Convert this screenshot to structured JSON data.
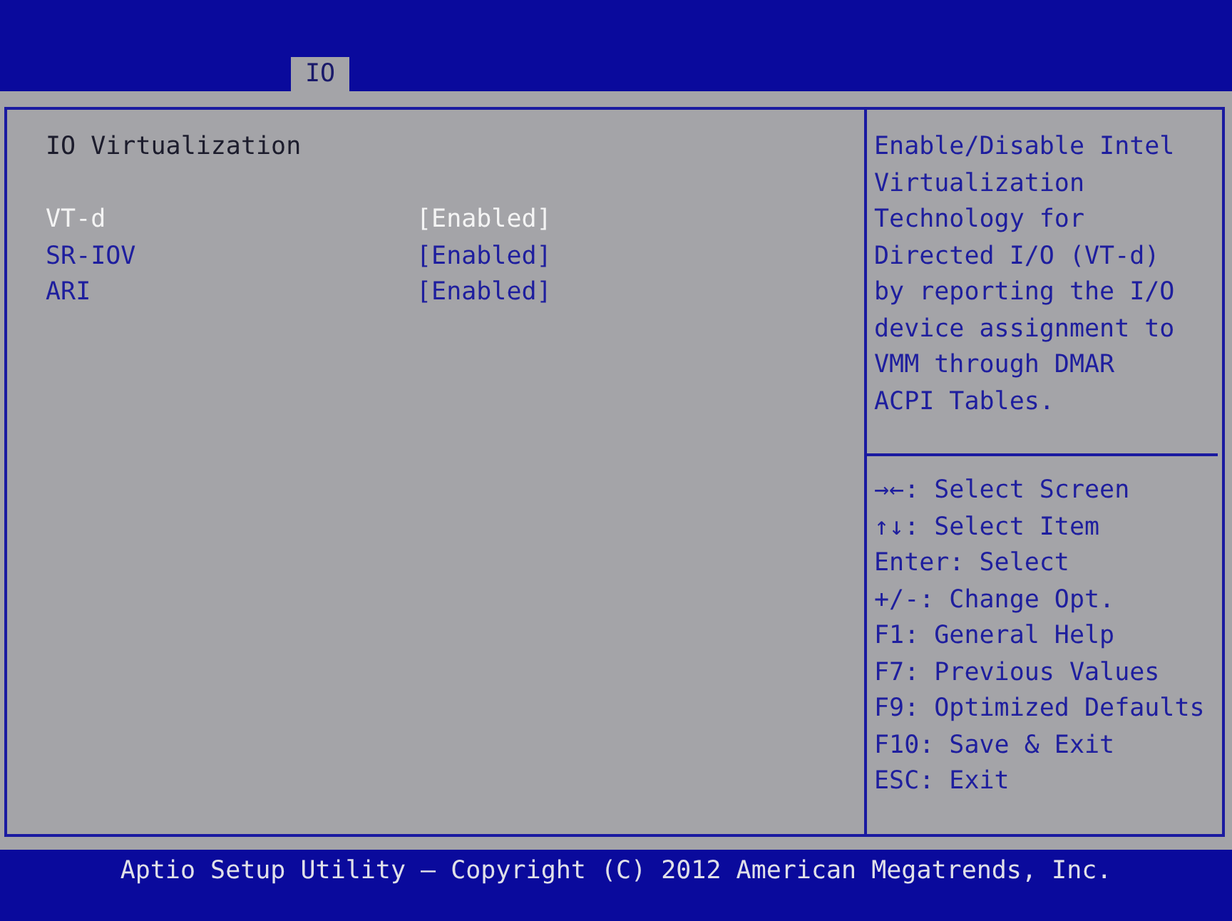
{
  "tabs": [
    {
      "label": "IO",
      "selected": true
    }
  ],
  "section_title": "IO Virtualization",
  "settings": [
    {
      "name": "VT-d",
      "value": "[Enabled]",
      "selected": true
    },
    {
      "name": "SR-IOV",
      "value": "[Enabled]",
      "selected": false
    },
    {
      "name": "ARI",
      "value": "[Enabled]",
      "selected": false
    }
  ],
  "help_text": "Enable/Disable Intel\nVirtualization\nTechnology for\nDirected I/O (VT-d)\nby reporting the I/O\ndevice assignment to\nVMM through DMAR\nACPI Tables.",
  "key_hints": [
    "→←: Select Screen",
    "↑↓: Select Item",
    "Enter: Select",
    "+/-: Change Opt.",
    "F1: General Help",
    "F7: Previous Values",
    "F9: Optimized Defaults",
    "F10: Save & Exit",
    "ESC: Exit"
  ],
  "footer": "Aptio Setup Utility – Copyright (C) 2012 American Megatrends, Inc."
}
